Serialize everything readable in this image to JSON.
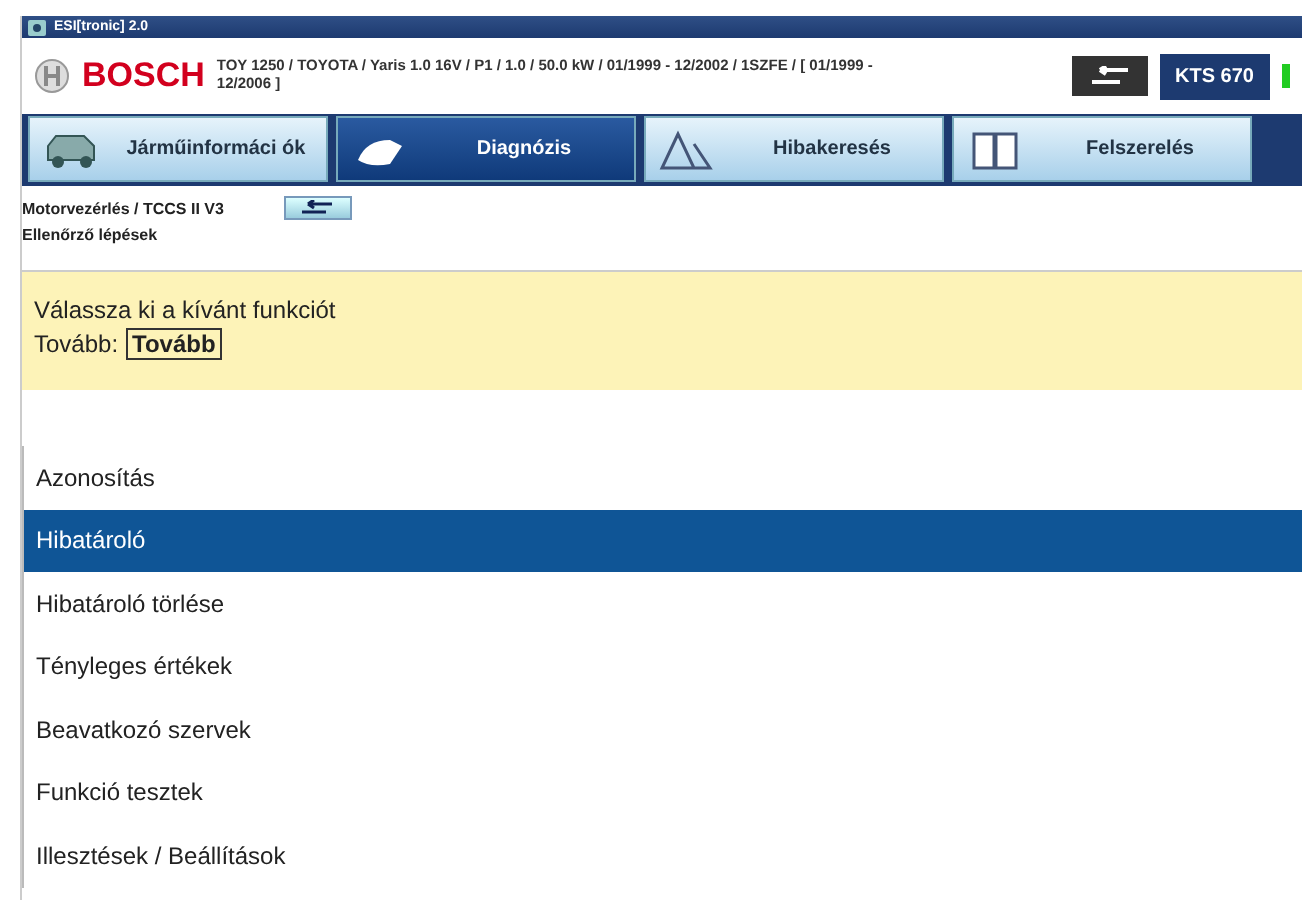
{
  "window": {
    "title": "ESI[tronic] 2.0"
  },
  "header": {
    "brand": "BOSCH",
    "vehicle": "TOY 1250 / TOYOTA / Yaris 1.0 16V / P1 / 1.0 / 50.0 kW / 01/1999 - 12/2002 / 1SZFE / [ 01/1999 - 12/2006 ]",
    "device": "KTS 670",
    "connected": true
  },
  "tabs": [
    {
      "label": "Járműinformáci ók",
      "kind": "car",
      "selected": false
    },
    {
      "label": "Diagnózis",
      "kind": "plug",
      "selected": true
    },
    {
      "label": "Hibakeresés",
      "kind": "warning",
      "selected": false
    },
    {
      "label": "Felszerelés",
      "kind": "book",
      "selected": false
    }
  ],
  "breadcrumb": "Motorvezérlés / TCCS II V3",
  "subtitle": "Ellenőrző lépések",
  "prompt": {
    "text": "Válassza ki a kívánt funkciót",
    "next_label": "Tovább:",
    "next_button": "Tovább"
  },
  "menu": [
    {
      "label": "Azonosítás",
      "selected": false
    },
    {
      "label": "Hibatároló",
      "selected": true
    },
    {
      "label": "Hibatároló törlése",
      "selected": false
    },
    {
      "label": "Tényleges értékek",
      "selected": false
    },
    {
      "label": "Beavatkozó szervek",
      "selected": false
    },
    {
      "label": "Funkció tesztek",
      "selected": false
    },
    {
      "label": "Illesztések / Beállítások",
      "selected": false
    }
  ]
}
